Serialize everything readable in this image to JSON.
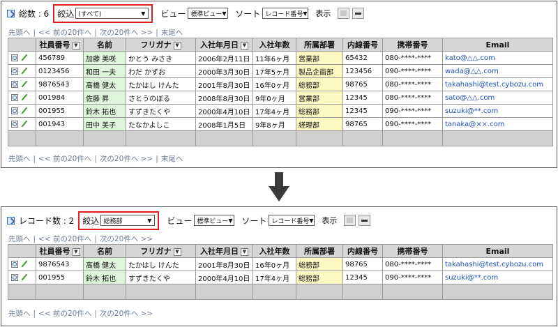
{
  "top": {
    "count_label": "総数 : 6",
    "filter_label": "絞込",
    "filter_value": "(すべて)",
    "view_label": "ビュー",
    "view_value": "標準ビュー",
    "sort_label": "ソート",
    "sort_value": "レコード番号",
    "display_label": "表示",
    "nav": {
      "first": "先頭へ",
      "prev": "<< 前の20件へ",
      "next": "次の20件へ >>",
      "last": "末尾へ"
    },
    "rows": [
      {
        "emp_no": "456789",
        "name": "加藤 美咲",
        "kana": "かとう みさき",
        "hire_date": "2006年2月11日",
        "tenure": "11年6ヶ月",
        "dept": "営業部",
        "ext": "65432",
        "mobile": "080-****-****",
        "email": "kato@△△.com"
      },
      {
        "emp_no": "0123456",
        "name": "和田 一夫",
        "kana": "わだ かずお",
        "hire_date": "2000年3月30日",
        "tenure": "17年5ヶ月",
        "dept": "製品企画部",
        "ext": "123456",
        "mobile": "090-****-****",
        "email": "wada@△△.com"
      },
      {
        "emp_no": "9876543",
        "name": "高橋 健太",
        "kana": "たかはし けんた",
        "hire_date": "2001年8月30日",
        "tenure": "16年0ヶ月",
        "dept": "総務部",
        "ext": "98765",
        "mobile": "080-****-****",
        "email": "takahashi@test.cybozu.com"
      },
      {
        "emp_no": "001984",
        "name": "佐藤 昇",
        "kana": "さとうのぼる",
        "hire_date": "2008年8月30日",
        "tenure": "9年0ヶ月",
        "dept": "営業部",
        "ext": "12345",
        "mobile": "080-****-****",
        "email": "sato@△△.com"
      },
      {
        "emp_no": "001955",
        "name": "鈴木 拓也",
        "kana": "すずきたくや",
        "hire_date": "2000年4月10日",
        "tenure": "17年4ヶ月",
        "dept": "総務部",
        "ext": "12345",
        "mobile": "090-****-****",
        "email": "suzuki@**.com"
      },
      {
        "emp_no": "001943",
        "name": "田中 美子",
        "kana": "たなかよしこ",
        "hire_date": "2008年1月5日",
        "tenure": "9年8ヶ月",
        "dept": "経理部",
        "ext": "98765",
        "mobile": "090-****-****",
        "email": "tanaka@××.com"
      }
    ]
  },
  "bottom": {
    "count_label": "レコード数 : 2",
    "filter_label": "絞込",
    "filter_value": "総務部",
    "view_label": "ビュー",
    "view_value": "標準ビュー",
    "sort_label": "ソート",
    "sort_value": "レコード番号",
    "display_label": "表示",
    "nav": {
      "first": "先頭へ",
      "prev": "<< 前の20件へ",
      "next": "次の20件へ >>"
    },
    "rows": [
      {
        "emp_no": "9876543",
        "name": "高橋 健太",
        "kana": "たかはし けんた",
        "hire_date": "2001年8月30日",
        "tenure": "16年0ヶ月",
        "dept": "総務部",
        "ext": "98765",
        "mobile": "080-****-****",
        "email": "takahashi@test.cybozu.com"
      },
      {
        "emp_no": "001955",
        "name": "鈴木 拓也",
        "kana": "すずきたくや",
        "hire_date": "2000年4月10日",
        "tenure": "17年4ヶ月",
        "dept": "総務部",
        "ext": "12345",
        "mobile": "090-****-****",
        "email": "suzuki@**.com"
      }
    ]
  },
  "columns": {
    "emp_no": "社員番号",
    "name": "名前",
    "kana": "フリガナ",
    "hire_date": "入社年月日",
    "tenure": "入社年数",
    "dept": "所属部署",
    "ext": "内線番号",
    "mobile": "携帯番号",
    "email": "Email"
  },
  "icons": {
    "open": "panel-icon",
    "sort": "sort-dropdown-icon",
    "detail": "magnifier-icon",
    "edit": "pencil-icon",
    "transition": "down-arrow-icon"
  },
  "colors": {
    "highlight_border": "#e0201a",
    "name_bg": "#ddf5d8",
    "dept_bg": "#fdf8c2",
    "link": "#1a50b8",
    "header_bg": "#d6d6d6"
  }
}
